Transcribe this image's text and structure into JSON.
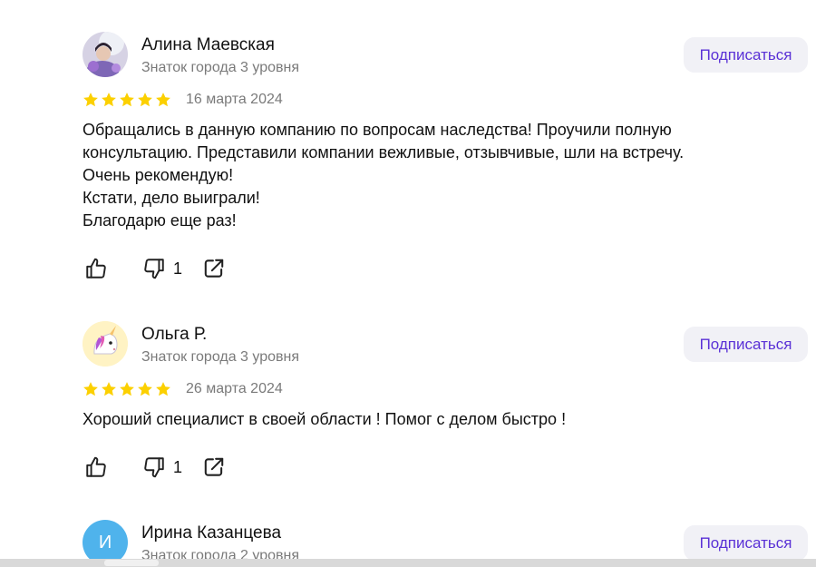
{
  "reviews": [
    {
      "name": "Алина Маевская",
      "level": "Знаток города 3 уровня",
      "subscribe_label": "Подписаться",
      "date": "16 марта 2024",
      "rating": 5,
      "text_lines": [
        "Обращались в данную компанию по вопросам наследства! Проучили полную",
        "консультацию. Представили компании вежливые, отзывчивые, шли на встречу.",
        "Очень рекомендую!",
        "Кстати, дело выиграли!",
        "Благодарю еще раз!"
      ],
      "likes": "",
      "dislikes": "1"
    },
    {
      "name": "Ольга Р.",
      "level": "Знаток города 3 уровня",
      "subscribe_label": "Подписаться",
      "date": "26 марта 2024",
      "rating": 5,
      "text_lines": [
        "Хороший специалист в своей области ! Помог с делом быстро !"
      ],
      "likes": "",
      "dislikes": "1"
    },
    {
      "name": "Ирина Казанцева",
      "level": "Знаток города 2 уровня",
      "subscribe_label": "Подписаться",
      "avatar_letter": "И"
    }
  ],
  "colors": {
    "accent": "#5a31d6",
    "star": "#fcd000",
    "avatar_blue": "#4fb3ec"
  },
  "icons": [
    "thumb-up-icon",
    "thumb-down-icon",
    "share-icon",
    "star-icon",
    "unicorn-icon"
  ]
}
